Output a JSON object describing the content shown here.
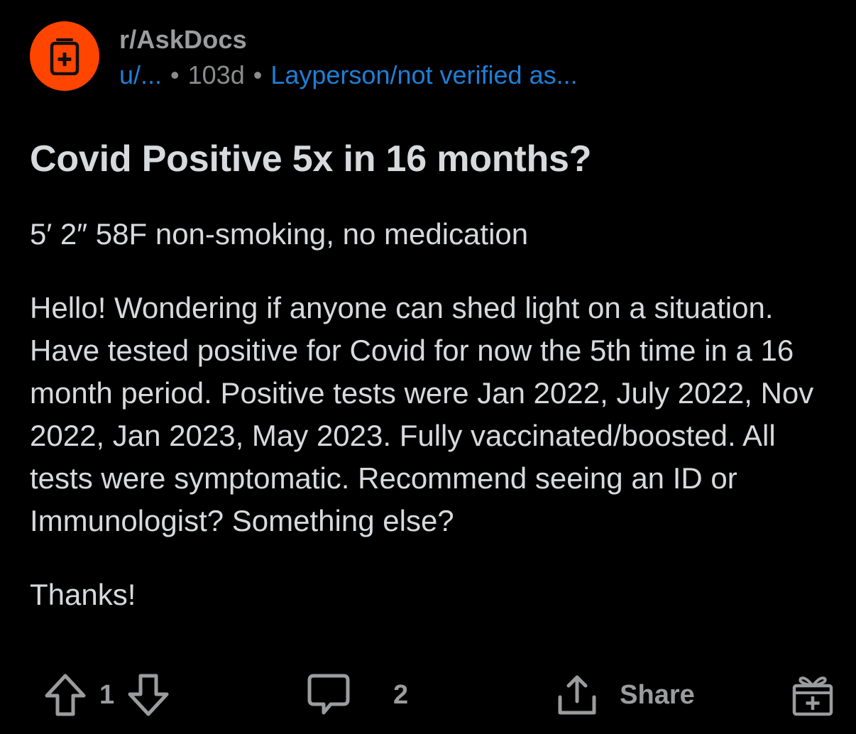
{
  "colors": {
    "background": "#000000",
    "brand_avatar": "#ff4500",
    "link_blue": "#1e7fd6",
    "muted": "#9a9c9e",
    "text": "#d7dadc"
  },
  "header": {
    "avatar_icon": "medicine-bottle-icon",
    "subreddit": "r/AskDocs",
    "username": "u/...",
    "separator": "•",
    "age": "103d",
    "flair": "Layperson/not verified as..."
  },
  "post": {
    "title": "Covid Positive 5x in 16 months?",
    "body_line1": "5′ 2″ 58F non-smoking, no medication",
    "body_paragraph": "Hello! Wondering if anyone can shed light on a situation. Have tested positive for Covid for now the 5th time in a 16 month period. Positive tests were Jan 2022, July 2022, Nov 2022, Jan 2023, May 2023. Fully vaccinated/boosted. All tests were symptomatic. Recommend seeing an ID or Immunologist? Something else?",
    "body_closing": "Thanks!"
  },
  "actions": {
    "upvote_icon": "upvote-arrow-icon",
    "vote_count": "1",
    "downvote_icon": "downvote-arrow-icon",
    "comment_icon": "comment-bubble-icon",
    "comment_count": "2",
    "share_icon": "share-upload-icon",
    "share_label": "Share",
    "award_icon": "gift-award-icon"
  }
}
